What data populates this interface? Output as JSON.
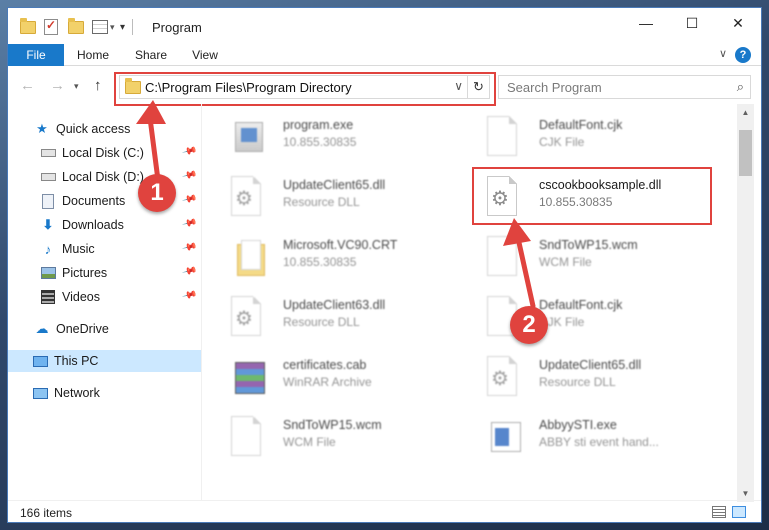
{
  "window": {
    "title": "Program",
    "controls": {
      "minimize": "—",
      "maximize": "☐",
      "close": "✕"
    }
  },
  "ribbon": {
    "tabs": [
      {
        "label": "File"
      },
      {
        "label": "Home"
      },
      {
        "label": "Share"
      },
      {
        "label": "View"
      }
    ],
    "help": "?"
  },
  "nav": {
    "address_path": "C:\\Program Files\\Program Directory",
    "search_placeholder": "Search Program"
  },
  "sidebar": {
    "items": [
      {
        "label": "Quick access",
        "icon": "star-icon"
      },
      {
        "label": "Local Disk (C:)",
        "icon": "drive-icon",
        "pinned": true
      },
      {
        "label": "Local Disk (D:)",
        "icon": "drive-icon",
        "pinned": true
      },
      {
        "label": "Documents",
        "icon": "documents-icon",
        "pinned": true
      },
      {
        "label": "Downloads",
        "icon": "download-icon",
        "pinned": true
      },
      {
        "label": "Music",
        "icon": "music-icon",
        "pinned": true
      },
      {
        "label": "Pictures",
        "icon": "pictures-icon",
        "pinned": true
      },
      {
        "label": "Videos",
        "icon": "videos-icon",
        "pinned": true
      },
      {
        "label": "OneDrive",
        "icon": "cloud-icon"
      },
      {
        "label": "This PC",
        "icon": "monitor-icon",
        "selected": true
      },
      {
        "label": "Network",
        "icon": "network-icon"
      }
    ]
  },
  "files": {
    "left": [
      {
        "name": "program.exe",
        "sub": "10.855.30835",
        "icon": "exe-icon"
      },
      {
        "name": "UpdateClient65.dll",
        "sub": "Resource DLL",
        "icon": "dll-icon"
      },
      {
        "name": "Microsoft.VC90.CRT",
        "sub": "10.855.30835",
        "icon": "folder-icon"
      },
      {
        "name": "UpdateClient63.dll",
        "sub": "Resource DLL",
        "icon": "dll-icon"
      },
      {
        "name": "certificates.cab",
        "sub": "WinRAR Archive",
        "icon": "archive-icon"
      },
      {
        "name": "SndToWP15.wcm",
        "sub": "WCM File",
        "icon": "file-icon"
      }
    ],
    "right": [
      {
        "name": "DefaultFont.cjk",
        "sub": "CJK File",
        "icon": "file-icon"
      },
      {
        "name": "cscookbooksample.dll",
        "sub": "10.855.30835",
        "icon": "dll-icon",
        "highlighted": true
      },
      {
        "name": "SndToWP15.wcm",
        "sub": "WCM File",
        "icon": "file-icon"
      },
      {
        "name": "DefaultFont.cjk",
        "sub": "CJK File",
        "icon": "file-icon"
      },
      {
        "name": "UpdateClient65.dll",
        "sub": "Resource DLL",
        "icon": "dll-icon"
      },
      {
        "name": "AbbyySTI.exe",
        "sub": "ABBY sti event hand...",
        "icon": "exe-icon"
      }
    ]
  },
  "status": {
    "item_count": "166 items"
  },
  "markers": {
    "step1": "1",
    "step2": "2"
  },
  "colors": {
    "accent": "#1979ca",
    "marker_red": "#e0433e",
    "selected_bg": "#cce8ff"
  }
}
